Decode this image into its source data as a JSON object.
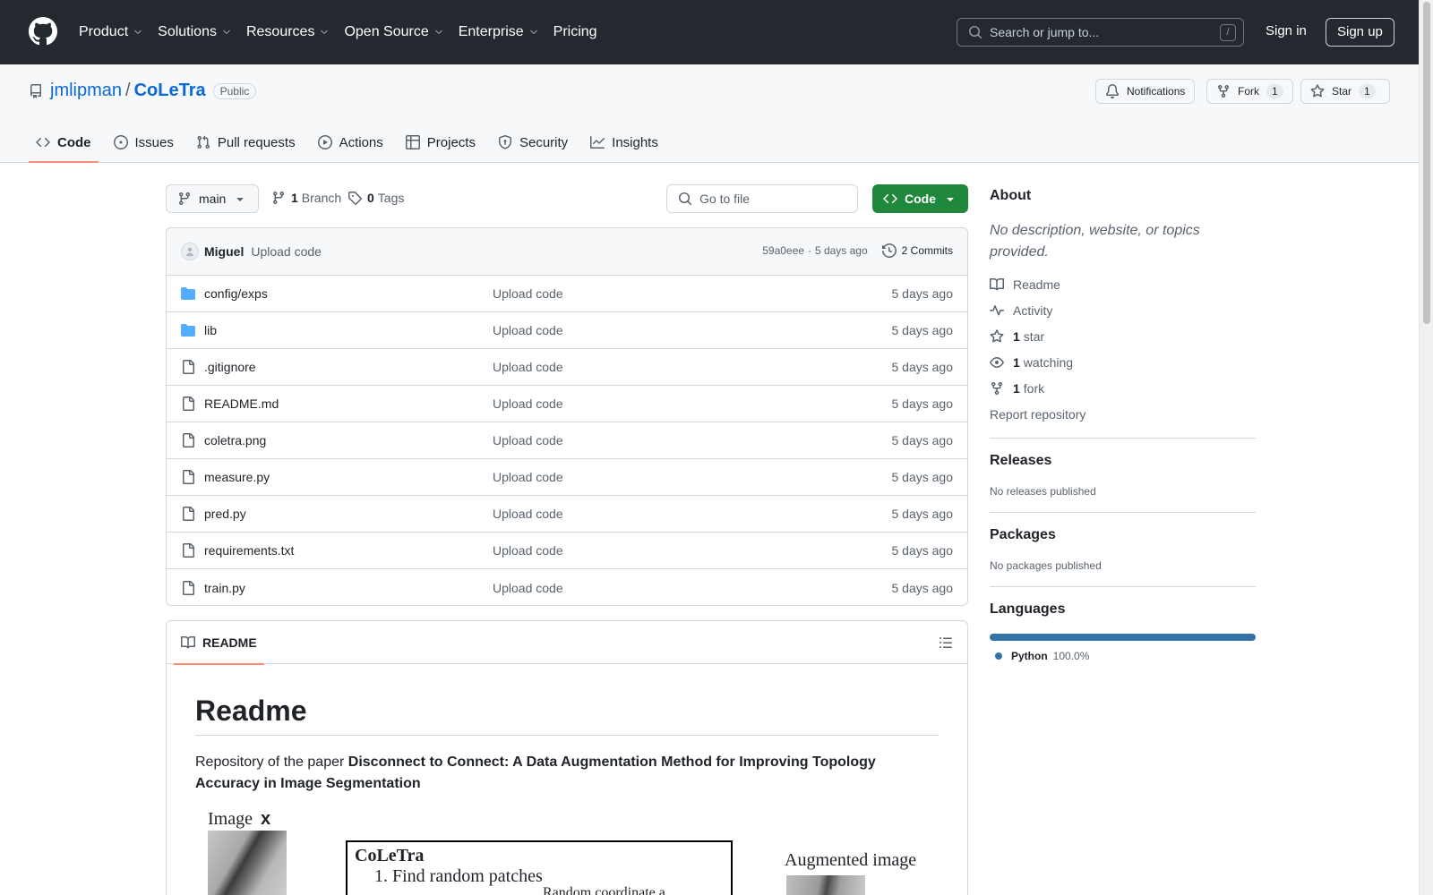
{
  "header": {
    "nav": [
      {
        "label": "Product",
        "chevron": true
      },
      {
        "label": "Solutions",
        "chevron": true
      },
      {
        "label": "Resources",
        "chevron": true
      },
      {
        "label": "Open Source",
        "chevron": true
      },
      {
        "label": "Enterprise",
        "chevron": true
      },
      {
        "label": "Pricing",
        "chevron": false
      }
    ],
    "search_placeholder": "Search or jump to...",
    "search_shortcut": "/",
    "signin": "Sign in",
    "signup": "Sign up"
  },
  "repo": {
    "owner": "jmlipman",
    "separator": "/",
    "name": "CoLeTra",
    "visibility": "Public",
    "notifications_label": "Notifications",
    "fork_label": "Fork",
    "fork_count": "1",
    "star_label": "Star",
    "star_count": "1",
    "tabs": [
      {
        "label": "Code",
        "icon": "code-icon",
        "active": true
      },
      {
        "label": "Issues",
        "icon": "issue-icon",
        "active": false
      },
      {
        "label": "Pull requests",
        "icon": "pull-request-icon",
        "active": false
      },
      {
        "label": "Actions",
        "icon": "play-icon",
        "active": false
      },
      {
        "label": "Projects",
        "icon": "table-icon",
        "active": false
      },
      {
        "label": "Security",
        "icon": "shield-icon",
        "active": false
      },
      {
        "label": "Insights",
        "icon": "graph-icon",
        "active": false
      }
    ]
  },
  "toolbar": {
    "branch": "main",
    "branch_count": "1",
    "branch_label": "Branch",
    "tag_count": "0",
    "tag_label": "Tags",
    "gofile_placeholder": "Go to file",
    "code_button": "Code"
  },
  "commit": {
    "author": "Miguel",
    "message": "Upload code",
    "hash": "59a0eee",
    "dot": "·",
    "time": "5 days ago",
    "commits": "2 Commits"
  },
  "files": [
    {
      "name": "config/exps",
      "type": "folder",
      "message": "Upload code",
      "date": "5 days ago"
    },
    {
      "name": "lib",
      "type": "folder",
      "message": "Upload code",
      "date": "5 days ago"
    },
    {
      "name": ".gitignore",
      "type": "file",
      "message": "Upload code",
      "date": "5 days ago"
    },
    {
      "name": "README.md",
      "type": "file",
      "message": "Upload code",
      "date": "5 days ago"
    },
    {
      "name": "coletra.png",
      "type": "file",
      "message": "Upload code",
      "date": "5 days ago"
    },
    {
      "name": "measure.py",
      "type": "file",
      "message": "Upload code",
      "date": "5 days ago"
    },
    {
      "name": "pred.py",
      "type": "file",
      "message": "Upload code",
      "date": "5 days ago"
    },
    {
      "name": "requirements.txt",
      "type": "file",
      "message": "Upload code",
      "date": "5 days ago"
    },
    {
      "name": "train.py",
      "type": "file",
      "message": "Upload code",
      "date": "5 days ago"
    }
  ],
  "readme": {
    "tab_label": "README",
    "title": "Readme",
    "intro": "Repository of the paper ",
    "paper_title": "Disconnect to Connect: A Data Augmentation Method for Improving Topology Accuracy in Image Segmentation",
    "figure": {
      "image_label": "Image",
      "image_var": "x",
      "box_title": "CoLeTra",
      "step1": "1. Find random patches",
      "step1_sub": "Random coordinate a",
      "augmented_label": "Augmented image"
    }
  },
  "sidebar": {
    "about_title": "About",
    "about_desc": "No description, website, or topics provided.",
    "links": [
      {
        "icon": "book-icon",
        "count": "",
        "label": "Readme"
      },
      {
        "icon": "pulse-icon",
        "count": "",
        "label": "Activity"
      },
      {
        "icon": "star-icon",
        "count": "1",
        "label": "star"
      },
      {
        "icon": "eye-icon",
        "count": "1",
        "label": "watching"
      },
      {
        "icon": "fork-icon",
        "count": "1",
        "label": "fork"
      }
    ],
    "report": "Report repository",
    "releases_title": "Releases",
    "releases_text": "No releases published",
    "packages_title": "Packages",
    "packages_text": "No packages published",
    "languages_title": "Languages",
    "language": "Python",
    "language_pct": "100.0%",
    "language_share": 1.0,
    "language_color": "#3572A5"
  },
  "colors": {
    "header_bg": "#24292f",
    "link": "#0969da",
    "primary_button": "#1f883d",
    "folder": "#54aeff",
    "active_tab_underline": "#fd8c73"
  }
}
